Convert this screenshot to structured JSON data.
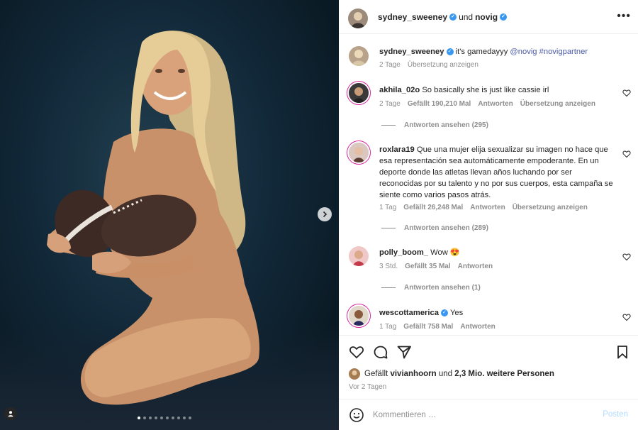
{
  "post": {
    "author": "sydney_sweeney",
    "conjunction": "und",
    "collaborator": "novig",
    "more_icon": "more-horizontal-icon"
  },
  "caption": {
    "user": "sydney_sweeney",
    "text": "it's gamedayyy",
    "mention": "@novig",
    "hashtag": "#novigpartner",
    "time": "2 Tage",
    "translate": "Übersetzung anzeigen"
  },
  "comments": [
    {
      "user": "akhila_02o",
      "text": "So basically she is just like cassie irl",
      "time": "2 Tage",
      "likes": "Gefällt 190,210 Mal",
      "reply": "Antworten",
      "translate": "Übersetzung anzeigen",
      "view_replies": "Antworten ansehen (295)"
    },
    {
      "user": "roxlara19",
      "text": "Que una mujer elija sexualizar su imagen no hace que esa representación sea automáticamente empoderante. En un deporte donde las atletas llevan años luchando por ser reconocidas por su talento y no por sus cuerpos, esta campaña se siente como varios pasos atrás.",
      "time": "1 Tag",
      "likes": "Gefällt 26,248 Mal",
      "reply": "Antworten",
      "translate": "Übersetzung anzeigen",
      "view_replies": "Antworten ansehen (289)"
    },
    {
      "user": "polly_boom_",
      "text": "Wow 😍",
      "time": "3 Std.",
      "likes": "Gefällt 35 Mal",
      "reply": "Antworten",
      "view_replies": "Antworten ansehen (1)"
    },
    {
      "user": "wescottamerica",
      "text": "Yes",
      "time": "1 Tag",
      "likes": "Gefällt 758 Mal",
      "reply": "Antworten"
    }
  ],
  "likes_line": {
    "prefix": "Gefällt",
    "user": "vivianhoorn",
    "mid": "und",
    "others": "2,3 Mio. weitere Personen"
  },
  "posted_ago": "Vor 2 Tagen",
  "composer": {
    "placeholder": "Kommentieren …",
    "post_label": "Posten"
  },
  "carousel": {
    "slides": 10,
    "current": 1
  },
  "colors": {
    "verified": "#3897f0",
    "link": "#4a5aa8",
    "muted": "#8e8e8e",
    "post_disabled": "#b3dbff"
  }
}
